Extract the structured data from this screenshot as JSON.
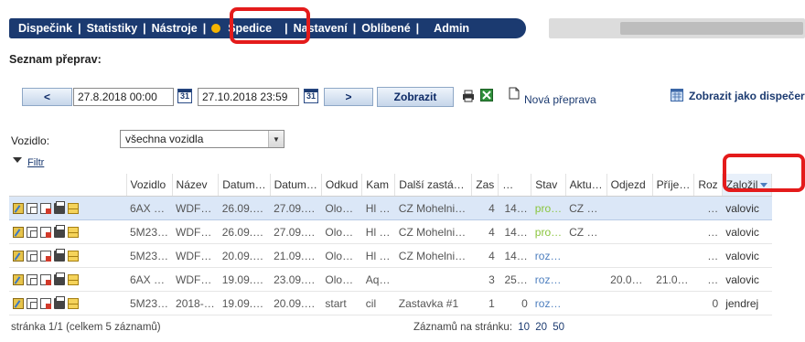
{
  "nav": {
    "items": [
      "Dispečink",
      "Statistiky",
      "Nástroje",
      "Spedice",
      "Nastavení",
      "Oblíbené",
      "Admin"
    ]
  },
  "page": {
    "title": "Seznam přeprav:"
  },
  "toolbar": {
    "prev_label": "<",
    "date_from": "27.8.2018 00:00",
    "date_to": "27.10.2018 23:59",
    "cal_label": "31",
    "next_label": ">",
    "show_label": "Zobrazit",
    "new_label": "Nová přeprava",
    "dispatch_label": "Zobrazit jako dispečer"
  },
  "filter": {
    "vehicle_label": "Vozidlo:",
    "vehicle_value": "všechna vozidla",
    "filter_label": "Filtr"
  },
  "table": {
    "headers": [
      "Vozidlo",
      "Název",
      "Datum…",
      "Datum…",
      "Odkud",
      "Kam",
      "Další zastá…",
      "Zas",
      "…",
      "Stav",
      "Aktu…",
      "Odjezd",
      "Příje…",
      "Roz",
      "Založil"
    ],
    "rows": [
      {
        "vozidlo": "6AX …",
        "nazev": "WDF…",
        "datum1": "26.09.…",
        "datum2": "27.09.…",
        "odkud": "Olo…",
        "kam": "Hl …",
        "dalsi": "CZ Mohelni…",
        "zas": "4",
        "x": "14…",
        "stav": "pro…",
        "aktu": "CZ …",
        "odjezd": "",
        "prije": "",
        "roz": "…",
        "zalozil": "valovic",
        "stav_color": "green"
      },
      {
        "vozidlo": "5M23…",
        "nazev": "WDF…",
        "datum1": "26.09.…",
        "datum2": "27.09.…",
        "odkud": "Olo…",
        "kam": "Hl …",
        "dalsi": "CZ Mohelni…",
        "zas": "4",
        "x": "14…",
        "stav": "pro…",
        "aktu": "CZ …",
        "odjezd": "",
        "prije": "",
        "roz": "…",
        "zalozil": "valovic",
        "stav_color": "green"
      },
      {
        "vozidlo": "5M23…",
        "nazev": "WDF…",
        "datum1": "20.09.…",
        "datum2": "21.09.…",
        "odkud": "Olo…",
        "kam": "Hl …",
        "dalsi": "CZ Mohelni…",
        "zas": "4",
        "x": "14…",
        "stav": "roz…",
        "aktu": "",
        "odjezd": "",
        "prije": "",
        "roz": "…",
        "zalozil": "valovic",
        "stav_color": "blue"
      },
      {
        "vozidlo": "6AX …",
        "nazev": "WDF…",
        "datum1": "19.09.…",
        "datum2": "23.09.…",
        "odkud": "Olo…",
        "kam": "Aq…",
        "dalsi": "",
        "zas": "3",
        "x": "25…",
        "stav": "roz…",
        "aktu": "",
        "odjezd": "20.0…",
        "prije": "21.0…",
        "roz": "…",
        "zalozil": "valovic",
        "stav_color": "blue"
      },
      {
        "vozidlo": "5M23…",
        "nazev": "2018-…",
        "datum1": "19.09.…",
        "datum2": "20.09.…",
        "odkud": "start",
        "kam": "cil",
        "dalsi": "Zastavka #1",
        "zas": "1",
        "x": "0",
        "stav": "roz…",
        "aktu": "",
        "odjezd": "",
        "prije": "",
        "roz": "0",
        "zalozil": "jendrej",
        "stav_color": "blue"
      }
    ]
  },
  "footer": {
    "pages": "stránka 1/1 (celkem 5 záznamů)",
    "per_page_label": "Záznamů na stránku:",
    "per_page_options": [
      "10",
      "20",
      "50"
    ]
  },
  "colors": {
    "nav_bg": "#1b3a70",
    "highlight": "#e41b1b",
    "accent": "#f5b400",
    "status_green": "#8ac53c",
    "status_blue": "#4e7fbf"
  }
}
